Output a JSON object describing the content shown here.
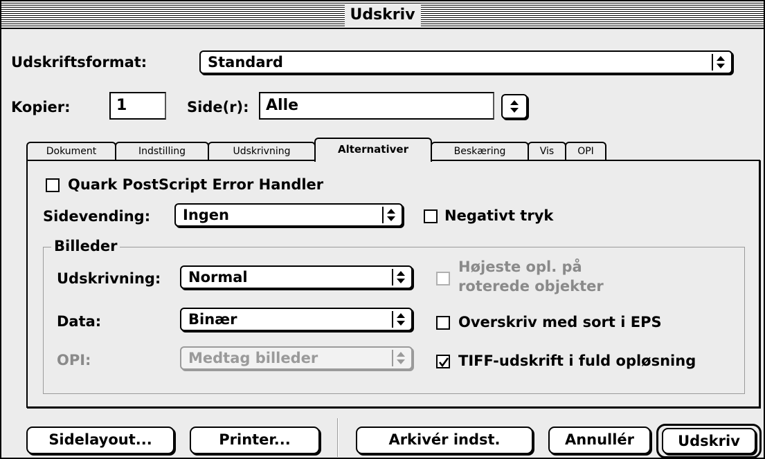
{
  "window": {
    "title": "Udskriv"
  },
  "format": {
    "label": "Udskriftsformat:",
    "value": "Standard"
  },
  "copies": {
    "label": "Kopier:",
    "value": "1"
  },
  "pages": {
    "label": "Side(r):",
    "value": "Alle"
  },
  "tabs": [
    {
      "label": "Dokument"
    },
    {
      "label": "Indstilling"
    },
    {
      "label": "Udskrivning"
    },
    {
      "label": "Alternativer"
    },
    {
      "label": "Beskæring"
    },
    {
      "label": "Vis"
    },
    {
      "label": "OPI"
    }
  ],
  "panel": {
    "error_handler": {
      "label": "Quark PostScript Error Handler",
      "checked": false
    },
    "flip": {
      "label": "Sidevending:",
      "value": "Ingen"
    },
    "negative": {
      "label": "Negativt tryk",
      "checked": false
    },
    "images": {
      "title": "Billeder",
      "output": {
        "label": "Udskrivning:",
        "value": "Normal"
      },
      "data": {
        "label": "Data:",
        "value": "Binær"
      },
      "opi": {
        "label": "OPI:",
        "value": "Medtag billeder",
        "disabled": true
      },
      "rotated": {
        "label_line1": "Højeste opl. på",
        "label_line2": "roterede objekter",
        "checked": false,
        "disabled": true
      },
      "overprint": {
        "label": "Overskriv med sort i EPS",
        "checked": false
      },
      "tiff": {
        "label": "TIFF-udskrift i fuld opløsning",
        "checked": true
      }
    }
  },
  "buttons": {
    "page_setup": "Sidelayout...",
    "printer": "Printer...",
    "save_settings": "Arkivér indst.",
    "cancel": "Annullér",
    "print": "Udskriv"
  },
  "colors": {
    "background": "#ececec",
    "disabled_text": "#8a8a8a",
    "border": "#000000"
  }
}
